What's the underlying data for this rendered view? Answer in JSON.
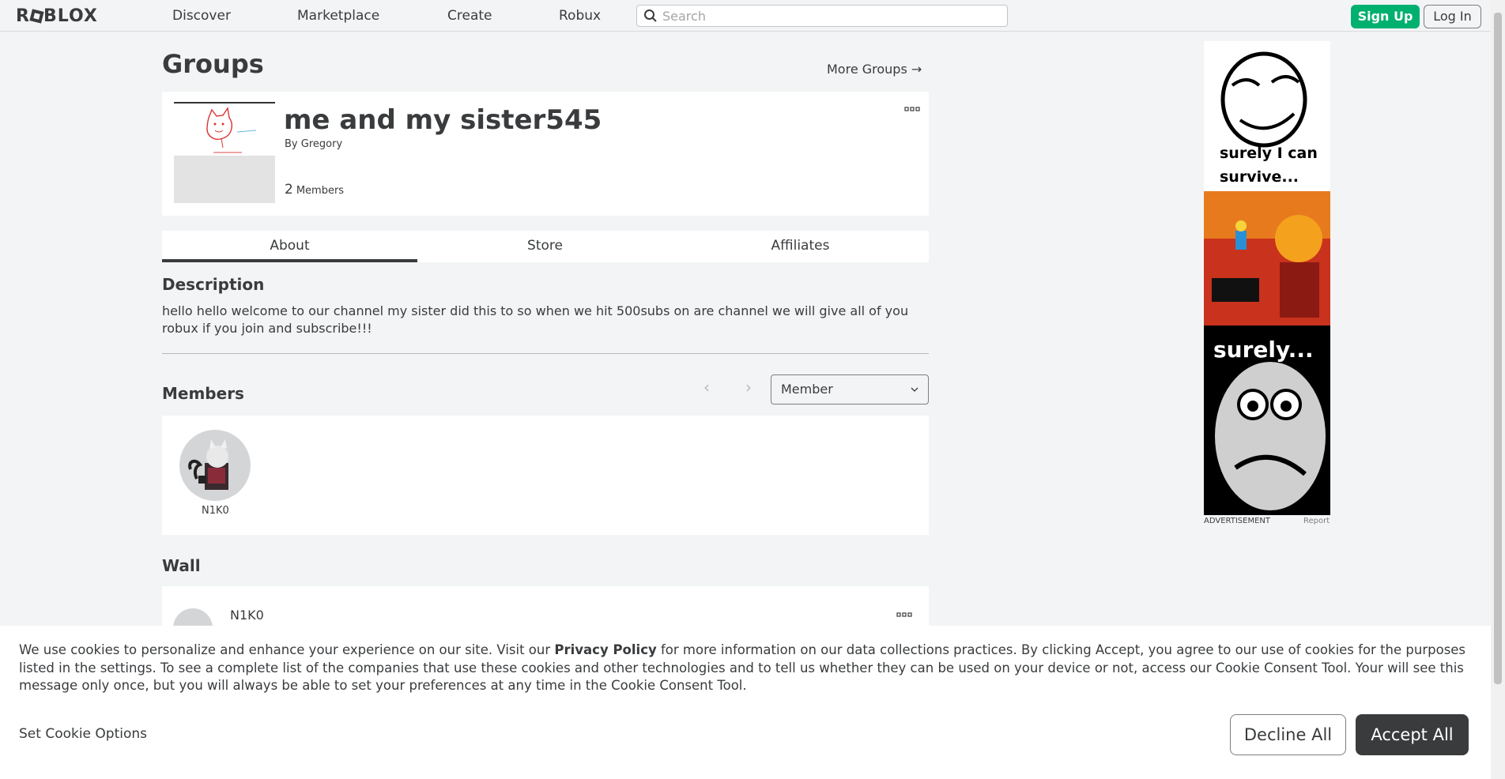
{
  "nav": {
    "logo": "ROBLOX",
    "links": [
      "Discover",
      "Marketplace",
      "Create",
      "Robux"
    ],
    "search_placeholder": "Search",
    "signup_label": "Sign Up",
    "login_label": "Log In"
  },
  "header": {
    "title": "Groups",
    "more_groups": "More Groups →"
  },
  "group": {
    "name": "me and my sister545",
    "by_prefix": "By",
    "owner": "Gregory",
    "member_count": "2",
    "member_label": "Members"
  },
  "tabs": [
    "About",
    "Store",
    "Affiliates"
  ],
  "description": {
    "title": "Description",
    "text": "hello hello welcome to our channel my sister did this to so when we hit 500subs on are channel we will give all of you robux if you join and subscribe!!!"
  },
  "members": {
    "title": "Members",
    "role_filter": "Member",
    "list": [
      {
        "name": "N1K0"
      }
    ]
  },
  "wall": {
    "title": "Wall",
    "posts": [
      {
        "user": "N1K0"
      }
    ]
  },
  "ad": {
    "caption_top": "surely I can survive...",
    "caption_bottom": "surely...",
    "label": "ADVERTISEMENT",
    "report": "Report"
  },
  "cookie": {
    "text_before": "We use cookies to personalize and enhance your experience on our site. Visit our ",
    "policy_link": "Privacy Policy",
    "text_after": " for more information on our data collections practices. By clicking Accept, you agree to our use of cookies for the purposes listed in the settings. To see a complete list of the companies that use these cookies and other technologies and to tell us whether they can be used on your device or not, access our Cookie Consent Tool. Your will see this message only once, but you will always be able to set your preferences at any time in the Cookie Consent Tool.",
    "set_options": "Set Cookie Options",
    "decline": "Decline All",
    "accept": "Accept All"
  },
  "colors": {
    "signup": "#00b06f",
    "background": "#f2f4f5",
    "text": "#393b3d",
    "accept_bg": "#393b3d"
  }
}
